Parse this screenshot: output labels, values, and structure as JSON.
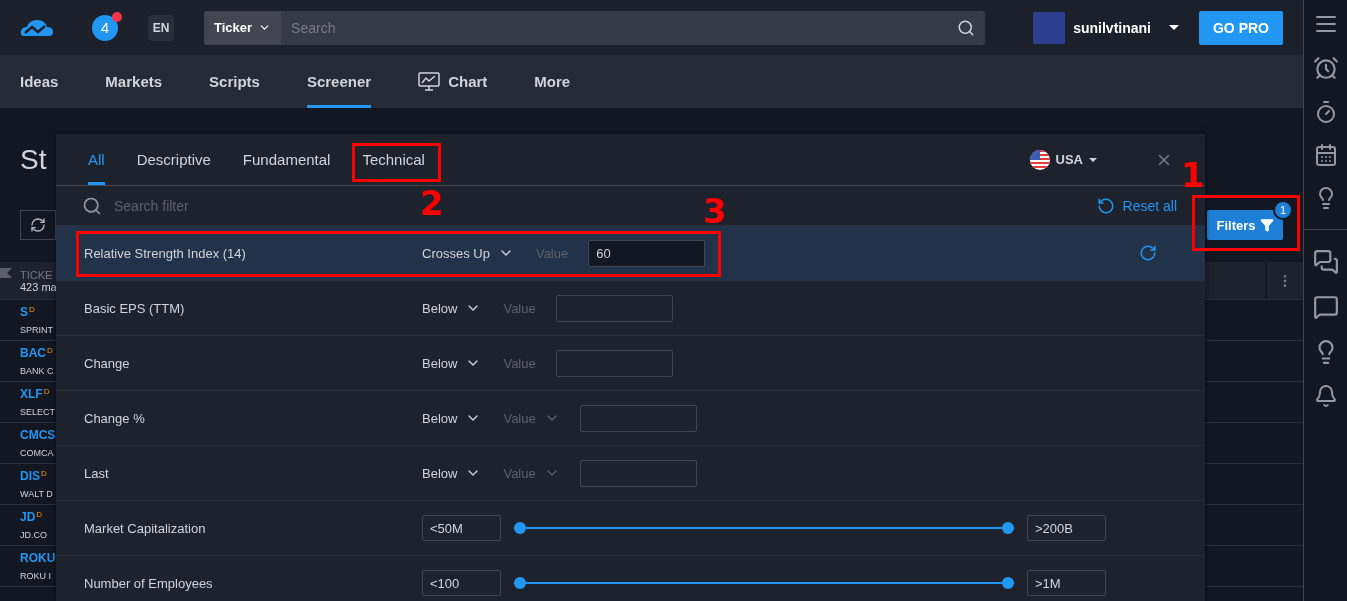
{
  "header": {
    "notifications": "4",
    "language": "EN",
    "search_scope": "Ticker",
    "search_placeholder": "Search",
    "username": "sunilvtinani",
    "go_pro": "GO PRO"
  },
  "nav": [
    {
      "label": "Ideas",
      "selected": false,
      "kind": "text"
    },
    {
      "label": "Markets",
      "selected": false,
      "kind": "text"
    },
    {
      "label": "Scripts",
      "selected": false,
      "kind": "text"
    },
    {
      "label": "Screener",
      "selected": true,
      "kind": "text"
    },
    {
      "label": "Chart",
      "selected": false,
      "kind": "chart"
    },
    {
      "label": "More",
      "selected": false,
      "kind": "text"
    }
  ],
  "page": {
    "title": "St",
    "filters_button": "Filters",
    "filters_count": "1",
    "table_header": {
      "column": "TICKE",
      "count": "423 ma"
    },
    "tickers": [
      {
        "symbol": "S",
        "badge": "D",
        "name": "SPRINT"
      },
      {
        "symbol": "BAC",
        "badge": "D",
        "name": "BANK C"
      },
      {
        "symbol": "XLF",
        "badge": "D",
        "name": "SELECT"
      },
      {
        "symbol": "CMCS",
        "name": "COMCA"
      },
      {
        "symbol": "DIS",
        "badge": "D",
        "name": "WALT D"
      },
      {
        "symbol": "JD",
        "badge": "D",
        "name": "JD.CO"
      },
      {
        "symbol": "ROKU",
        "name": "ROKU I"
      }
    ]
  },
  "filter_panel": {
    "tabs": [
      {
        "label": "All",
        "selected": true
      },
      {
        "label": "Descriptive",
        "selected": false
      },
      {
        "label": "Fundamental",
        "selected": false
      },
      {
        "label": "Technical",
        "selected": false
      }
    ],
    "market": "USA",
    "search_placeholder": "Search filter",
    "reset_all": "Reset all",
    "rows": [
      {
        "kind": "value",
        "label": "Relative Strength Index (14)",
        "operator": "Crosses Up",
        "value_label": "Value",
        "value_dropdown": false,
        "value": "60",
        "active": true
      },
      {
        "kind": "value",
        "label": "Basic EPS (TTM)",
        "operator": "Below",
        "value_label": "Value",
        "value_dropdown": false,
        "value": "",
        "active": false
      },
      {
        "kind": "value",
        "label": "Change",
        "operator": "Below",
        "value_label": "Value",
        "value_dropdown": false,
        "value": "",
        "active": false
      },
      {
        "kind": "value",
        "label": "Change %",
        "operator": "Below",
        "value_label": "Value",
        "value_dropdown": true,
        "value": "",
        "active": false
      },
      {
        "kind": "value",
        "label": "Last",
        "operator": "Below",
        "value_label": "Value",
        "value_dropdown": true,
        "value": "",
        "active": false
      },
      {
        "kind": "range",
        "label": "Market Capitalization",
        "min": "<50M",
        "max": ">200B",
        "thumbs": [
          {
            "level": 0
          },
          {
            "level": 1
          }
        ]
      },
      {
        "kind": "range",
        "label": "Number of Employees",
        "min": "<100",
        "max": ">1M",
        "thumbs": [
          {
            "level": 0
          },
          {
            "level": 1
          }
        ]
      }
    ]
  },
  "annotations": [
    {
      "number": "1"
    },
    {
      "number": "2"
    },
    {
      "number": "3"
    }
  ]
}
